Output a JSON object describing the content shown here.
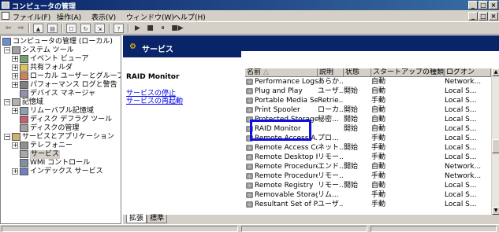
{
  "window": {
    "title": "コンピュータの管理",
    "controls": {
      "minimize": "_",
      "restore": "□",
      "close": "×"
    }
  },
  "menu": {
    "items": [
      "ファイル(F)",
      "操作(A)",
      "表示(V)",
      "ウィンドウ(W)",
      "ヘルプ(H)"
    ],
    "mdi_controls": {
      "minimize": "_",
      "restore": "□",
      "close": "×"
    }
  },
  "toolbar": {
    "back": "⇦",
    "forward": "⇨",
    "play": "▶",
    "stop": "■",
    "pause": "⏸",
    "restart": "■▶"
  },
  "tree": {
    "nodes": [
      {
        "label": "コンピュータの管理 (ローカル)"
      },
      {
        "label": "システム ツール"
      },
      {
        "label": "イベント ビューア"
      },
      {
        "label": "共有フォルダ"
      },
      {
        "label": "ローカル ユーザーとグループ"
      },
      {
        "label": "パフォーマンス ログと警告"
      },
      {
        "label": "デバイス マネージャ"
      },
      {
        "label": "記憶域"
      },
      {
        "label": "リムーバブル記憶域"
      },
      {
        "label": "ディスク デフラグ ツール"
      },
      {
        "label": "ディスクの管理"
      },
      {
        "label": "サービスとアプリケーション"
      },
      {
        "label": "テレフォニー"
      },
      {
        "label": "サービス"
      },
      {
        "label": "WMI コントロール"
      },
      {
        "label": "インデックス サービス"
      }
    ]
  },
  "header": {
    "title": "サービス"
  },
  "info": {
    "service_name": "RAID Monitor",
    "stop_link": "サービスの停止",
    "restart_link": "サービスの再起動"
  },
  "columns": [
    "名前",
    "説明",
    "状態",
    "スタートアップの種類",
    "ログオン"
  ],
  "sort_indicator": "△",
  "services": [
    [
      "Performance Logs ...",
      "あらか...",
      "",
      "自動",
      "Network..."
    ],
    [
      "Plug and Play",
      "ユーザ...",
      "開始",
      "自動",
      "Local S..."
    ],
    [
      "Portable Media Seri...",
      "Retrie...",
      "",
      "手動",
      "Local S..."
    ],
    [
      "Print Spooler",
      "ローカ...",
      "開始",
      "自動",
      "Local S..."
    ],
    [
      "Protected Storage",
      "秘密...",
      "開始",
      "自動",
      "Local S..."
    ],
    [
      "RAID Monitor",
      "",
      "開始",
      "自動",
      "Local S..."
    ],
    [
      "Remote Access A...",
      "プロ...",
      "",
      "手動",
      "Local S..."
    ],
    [
      "Remote Access Co...",
      "ネット...",
      "開始",
      "手動",
      "Local S..."
    ],
    [
      "Remote Desktop H...",
      "リモー...",
      "",
      "手動",
      "Local S..."
    ],
    [
      "Remote Procedure ...",
      "エンド...",
      "開始",
      "自動",
      "Network..."
    ],
    [
      "Remote Procedure ...",
      "リモー...",
      "",
      "手動",
      "Network..."
    ],
    [
      "Remote Registry",
      "リモー...",
      "開始",
      "自動",
      "Local S..."
    ],
    [
      "Removable Storage",
      "リム...",
      "",
      "手動",
      "Local S..."
    ],
    [
      "Resultant Set of P...",
      "ユーザ...",
      "",
      "手動",
      "Local S..."
    ]
  ],
  "tabs": [
    "拡張",
    "標準"
  ]
}
